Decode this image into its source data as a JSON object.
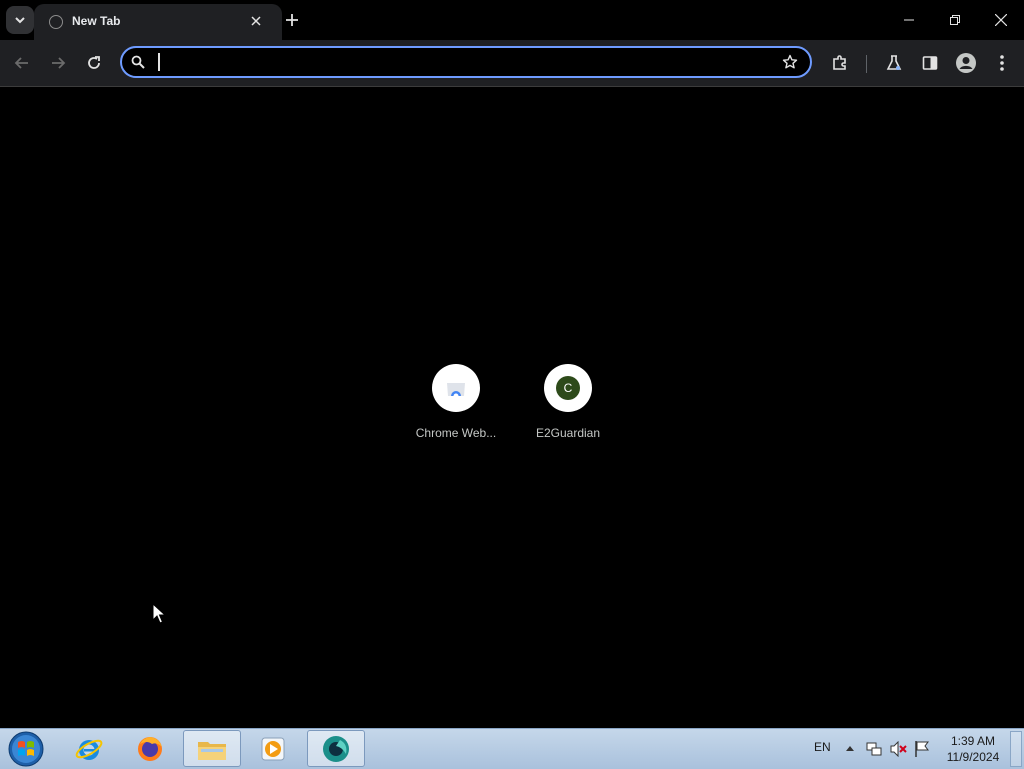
{
  "browser": {
    "tab": {
      "title": "New Tab"
    },
    "omnibox": {
      "value": "",
      "placeholder": ""
    }
  },
  "shortcuts": [
    {
      "label": "Chrome Web...",
      "icon": "chrome-web-store-icon"
    },
    {
      "label": "E2Guardian",
      "icon": "letter-c-icon",
      "letter": "C"
    }
  ],
  "taskbar": {
    "apps": [
      "internet-explorer-icon",
      "firefox-icon",
      "file-explorer-icon",
      "media-player-icon",
      "chrome-icon"
    ],
    "tray": {
      "language": "EN"
    },
    "clock": {
      "time": "1:39 AM",
      "date": "11/9/2024"
    }
  },
  "colors": {
    "accent": "#6e9bff",
    "background": "#000000",
    "toolbar": "#1f2023"
  }
}
